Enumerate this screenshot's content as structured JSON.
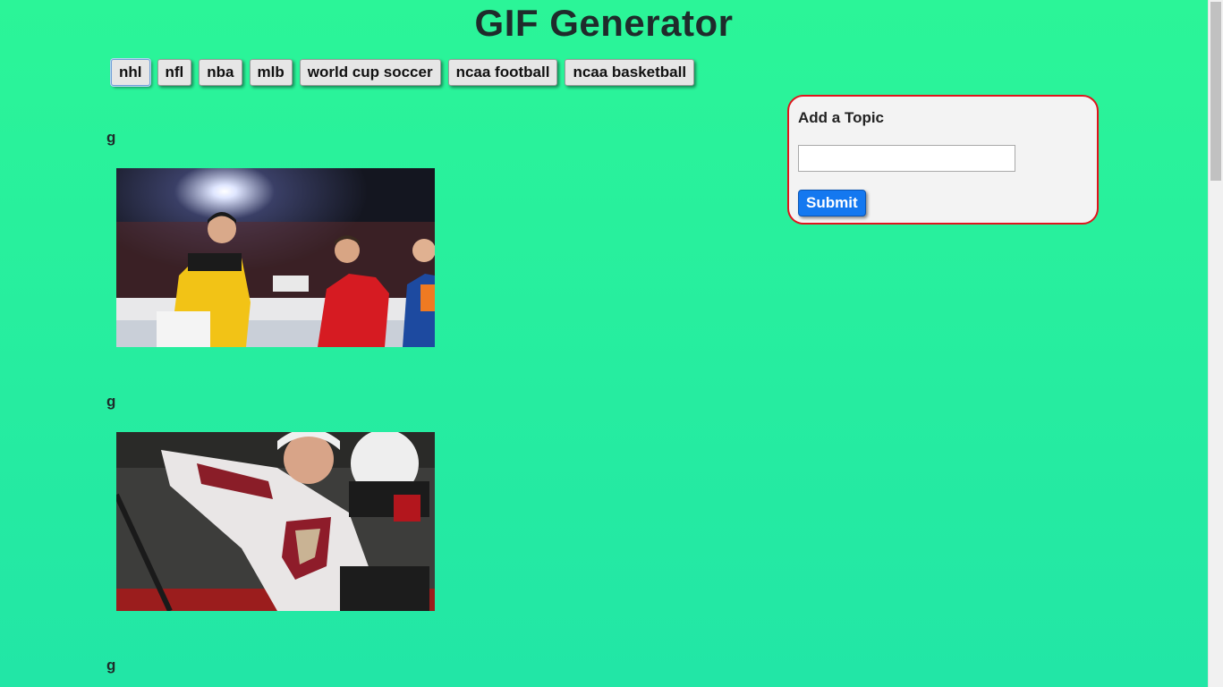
{
  "page": {
    "title": "GIF Generator"
  },
  "topics": [
    {
      "label": "nhl"
    },
    {
      "label": "nfl"
    },
    {
      "label": "nba"
    },
    {
      "label": "mlb"
    },
    {
      "label": "world cup soccer"
    },
    {
      "label": "ncaa football"
    },
    {
      "label": "ncaa basketball"
    }
  ],
  "gifs": [
    {
      "rating": "g",
      "image": "nhl-all-star-handshake"
    },
    {
      "rating": "g",
      "image": "coyotes-player-on-bench"
    },
    {
      "rating": "g"
    }
  ],
  "add_topic": {
    "heading": "Add a Topic",
    "input_value": "",
    "submit_label": "Submit"
  },
  "colors": {
    "background_top": "#2bf598",
    "background_bottom": "#22e6a6",
    "panel_border": "#e0141c",
    "submit_blue": "#1478f0"
  }
}
